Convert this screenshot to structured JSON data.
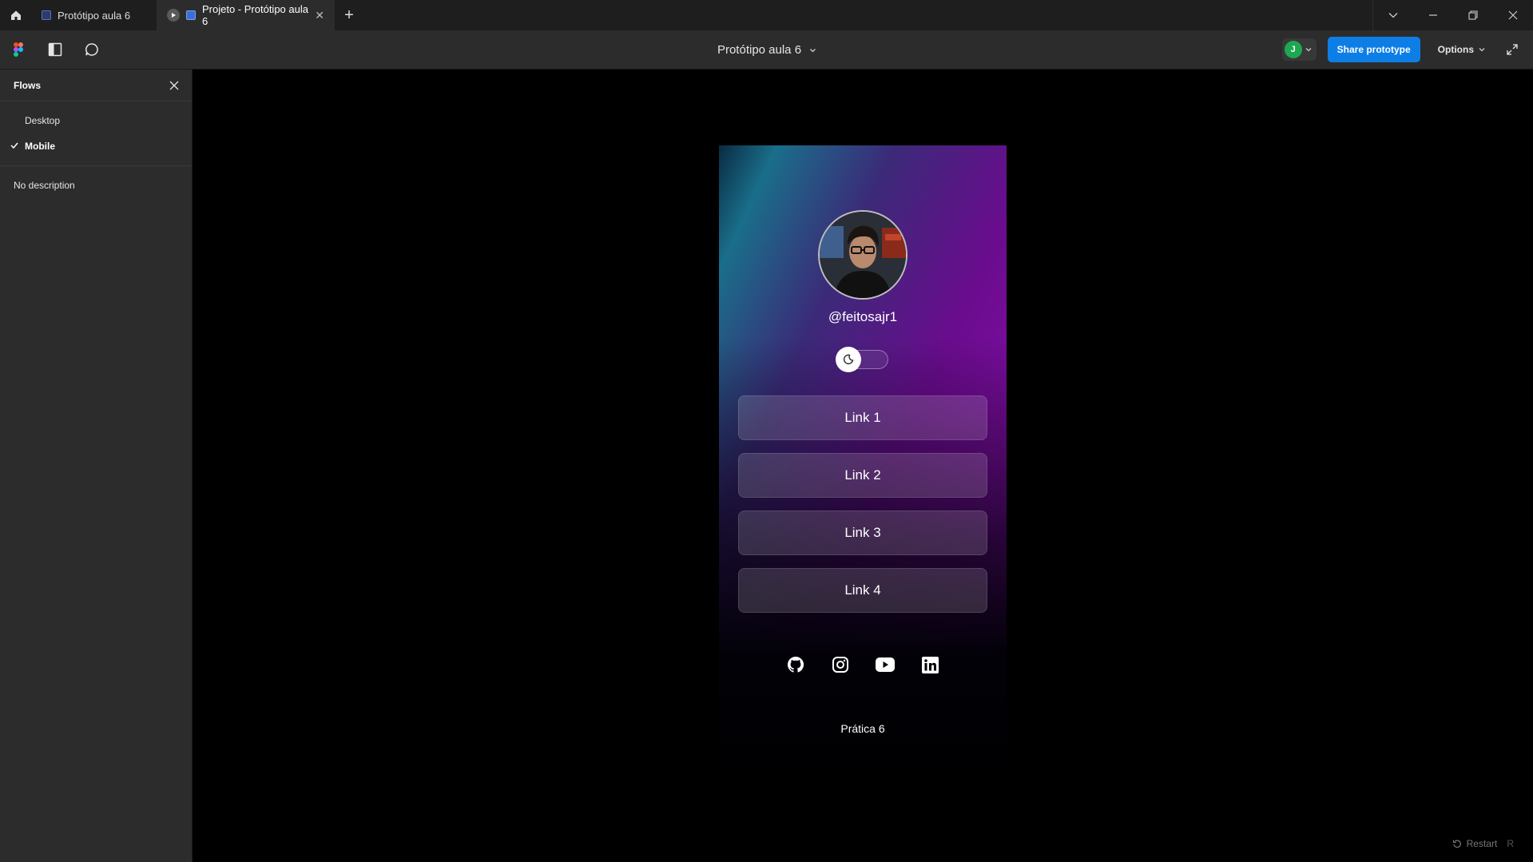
{
  "titlebar": {
    "tabs": [
      {
        "label": "Protótipo aula 6"
      },
      {
        "label": "Projeto - Protótipo aula 6"
      }
    ],
    "new_tab": "+"
  },
  "toolbar": {
    "project_title": "Protótipo aula 6",
    "avatar_initial": "J",
    "share_label": "Share prototype",
    "options_label": "Options"
  },
  "sidebar": {
    "title": "Flows",
    "flows": [
      {
        "label": "Desktop",
        "selected": false
      },
      {
        "label": "Mobile",
        "selected": true
      }
    ],
    "description": "No description"
  },
  "prototype": {
    "handle": "@feitosajr1",
    "links": [
      "Link 1",
      "Link 2",
      "Link 3",
      "Link 4"
    ],
    "social_icons": [
      "github-icon",
      "instagram-icon",
      "youtube-icon",
      "linkedin-icon"
    ],
    "footer": "Prática 6"
  },
  "canvas": {
    "restart_label": "Restart",
    "restart_shortcut": "R"
  },
  "colors": {
    "accent": "#0d7ee6",
    "avatar_bg": "#1da851",
    "gradient_magenta": "#a00bc2",
    "gradient_teal": "#1a6e8a"
  }
}
